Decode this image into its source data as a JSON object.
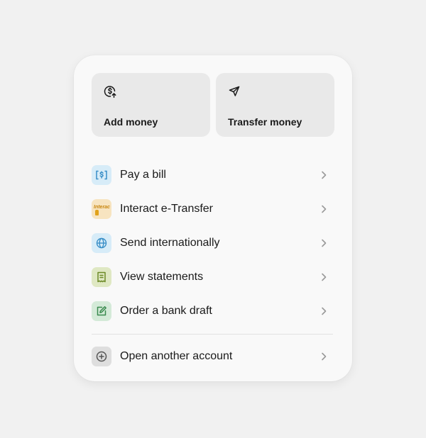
{
  "quick_actions": [
    {
      "label": "Add money",
      "icon": "dollar-add-icon"
    },
    {
      "label": "Transfer money",
      "icon": "paper-plane-icon"
    }
  ],
  "menu": [
    {
      "label": "Pay a bill",
      "icon": "bill-icon",
      "bg": "#d7ecf8",
      "color": "#3a8fc7"
    },
    {
      "label": "Interact e-Transfer",
      "icon": "interac-logo",
      "bg": "#f7e4c0",
      "color": "#e0a21b",
      "logo_text": "Interac"
    },
    {
      "label": "Send internationally",
      "icon": "globe-icon",
      "bg": "#d7ecf8",
      "color": "#3a8fc7"
    },
    {
      "label": "View statements",
      "icon": "statement-icon",
      "bg": "#dfe8c3",
      "color": "#6d8a27"
    },
    {
      "label": "Order a bank draft",
      "icon": "edit-document-icon",
      "bg": "#d4ead8",
      "color": "#3a8a4e"
    }
  ],
  "footer_action": {
    "label": "Open another account",
    "icon": "plus-circle-icon",
    "bg": "#dedede",
    "color": "#555555"
  }
}
